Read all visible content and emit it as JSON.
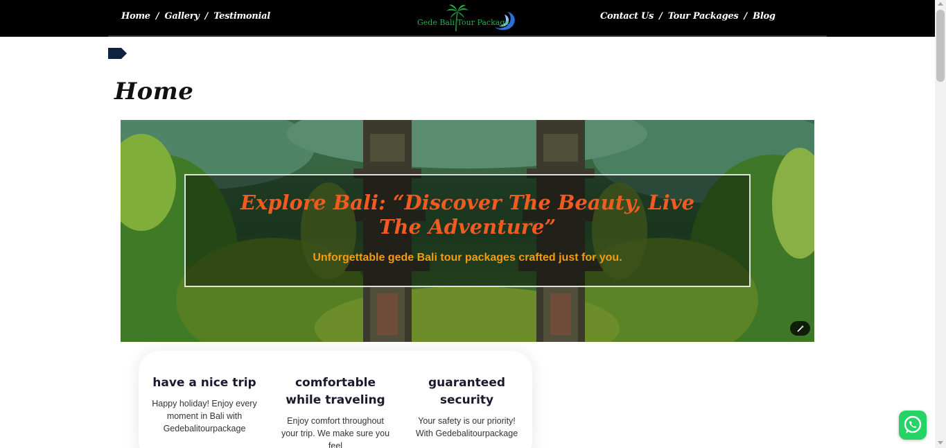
{
  "nav": {
    "left": [
      {
        "label": "Home"
      },
      {
        "label": "Gallery"
      },
      {
        "label": "Testimonial"
      }
    ],
    "right": [
      {
        "label": "Contact Us"
      },
      {
        "label": "Tour Packages"
      },
      {
        "label": "Blog"
      }
    ],
    "separator": "/"
  },
  "logo": {
    "text": "Gede Bali Tour Package",
    "icon": "palm-tree-wave-logo"
  },
  "page": {
    "title": "Home",
    "tag_icon": "tag-icon"
  },
  "hero": {
    "heading": "Explore Bali: “Discover The Beauty, Live The Adventure”",
    "subheading": "Unforgettable gede Bali tour packages crafted just for you.",
    "magic_icon": "magic-wand-icon"
  },
  "features": [
    {
      "title": "have a nice trip",
      "text": "Happy holiday! Enjoy every moment in Bali with Gedebalitourpackage"
    },
    {
      "title": "comfortable while traveling",
      "text": "Enjoy comfort throughout your trip. We make sure you feel"
    },
    {
      "title": "guaranteed security",
      "text": "Your safety is our priority! With Gedebalitourpackage"
    }
  ],
  "colors": {
    "topbar": "#000000",
    "heading_accent": "#f15a22",
    "subheading_accent": "#f39c12",
    "whatsapp": "#25d366"
  },
  "whatsapp": {
    "icon": "whatsapp-icon"
  }
}
